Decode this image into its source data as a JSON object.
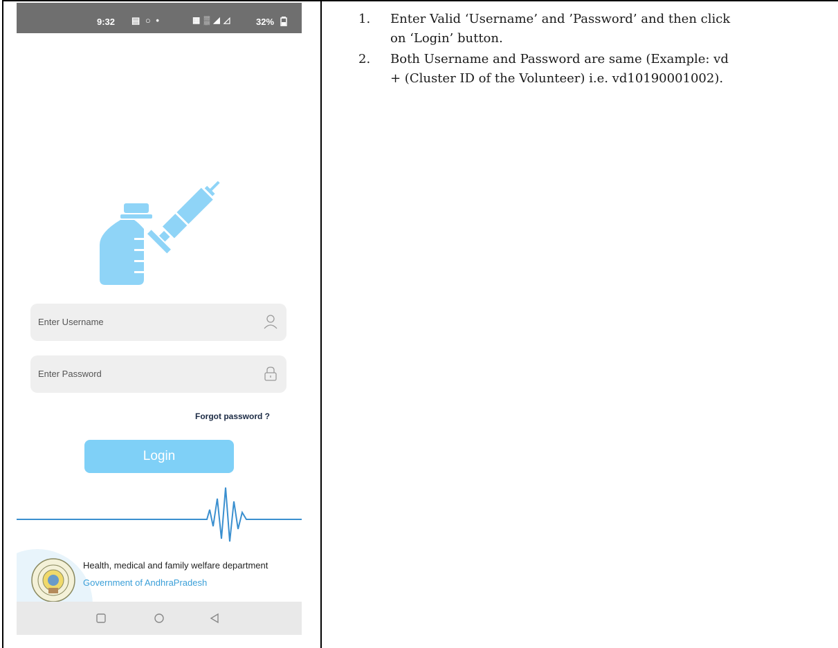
{
  "phone": {
    "status_bar": {
      "time": "9:32",
      "notification_icons": "▤ ○ •",
      "signal_icons": "▦ ▒ ◢ ◿",
      "battery": "32%"
    },
    "username_placeholder": "Enter Username",
    "password_placeholder": "Enter Password",
    "forgot_password": "Forgot password ?",
    "login_button": "Login",
    "footer": {
      "department": "Health, medical and family welfare department",
      "government": "Government of AndhraPradesh"
    },
    "colors": {
      "accent": "#7fd0f7",
      "icon": "#8fd4f7",
      "pulse": "#3a8fcf",
      "link": "#3a9fd8"
    },
    "icons": [
      "vaccine-logo-icon",
      "person-icon",
      "lock-icon",
      "state-seal-icon",
      "recent-apps-icon",
      "home-icon",
      "back-icon"
    ]
  },
  "instructions": [
    {
      "number": "1.",
      "line1": "Enter Valid ‘Username’ and ’Password’ and then click",
      "line2": "on ‘Login’ button."
    },
    {
      "number": "2.",
      "line1": "Both Username and Password are same (Example: vd",
      "line2": "+ (Cluster ID of the Volunteer) i.e. vd10190001002)."
    }
  ]
}
